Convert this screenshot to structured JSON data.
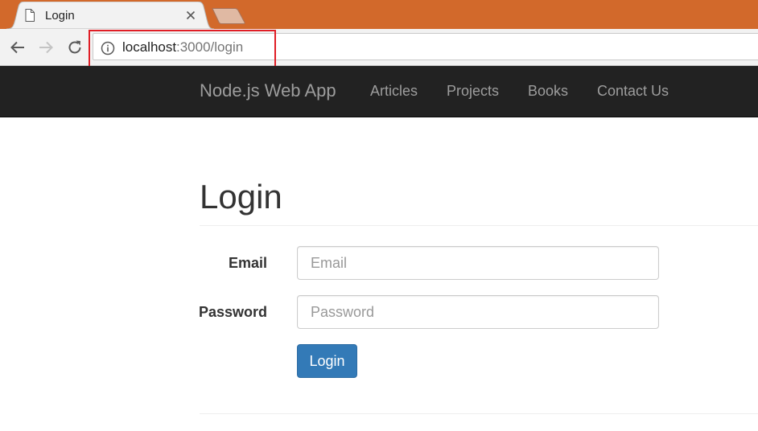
{
  "browser": {
    "tab": {
      "title": "Login",
      "icon": "page-icon",
      "close_icon": "close-icon"
    },
    "new_tab_icon": "new-tab-icon",
    "nav_icons": [
      "back-arrow-icon",
      "forward-arrow-icon",
      "reload-icon"
    ],
    "omnibox": {
      "info_icon": "info-icon",
      "url_host": "localhost",
      "url_path": ":3000/login"
    },
    "colors": {
      "tabstrip": "#d2692b",
      "highlight_box": "#e01e26"
    }
  },
  "navbar": {
    "brand": "Node.js Web App",
    "links": [
      "Articles",
      "Projects",
      "Books",
      "Contact Us"
    ],
    "background": "#222222"
  },
  "main": {
    "title": "Login",
    "form": {
      "email_label": "Email",
      "email_placeholder": "Email",
      "password_label": "Password",
      "password_placeholder": "Password",
      "submit_label": "Login",
      "submit_color": "#337ab7"
    }
  }
}
